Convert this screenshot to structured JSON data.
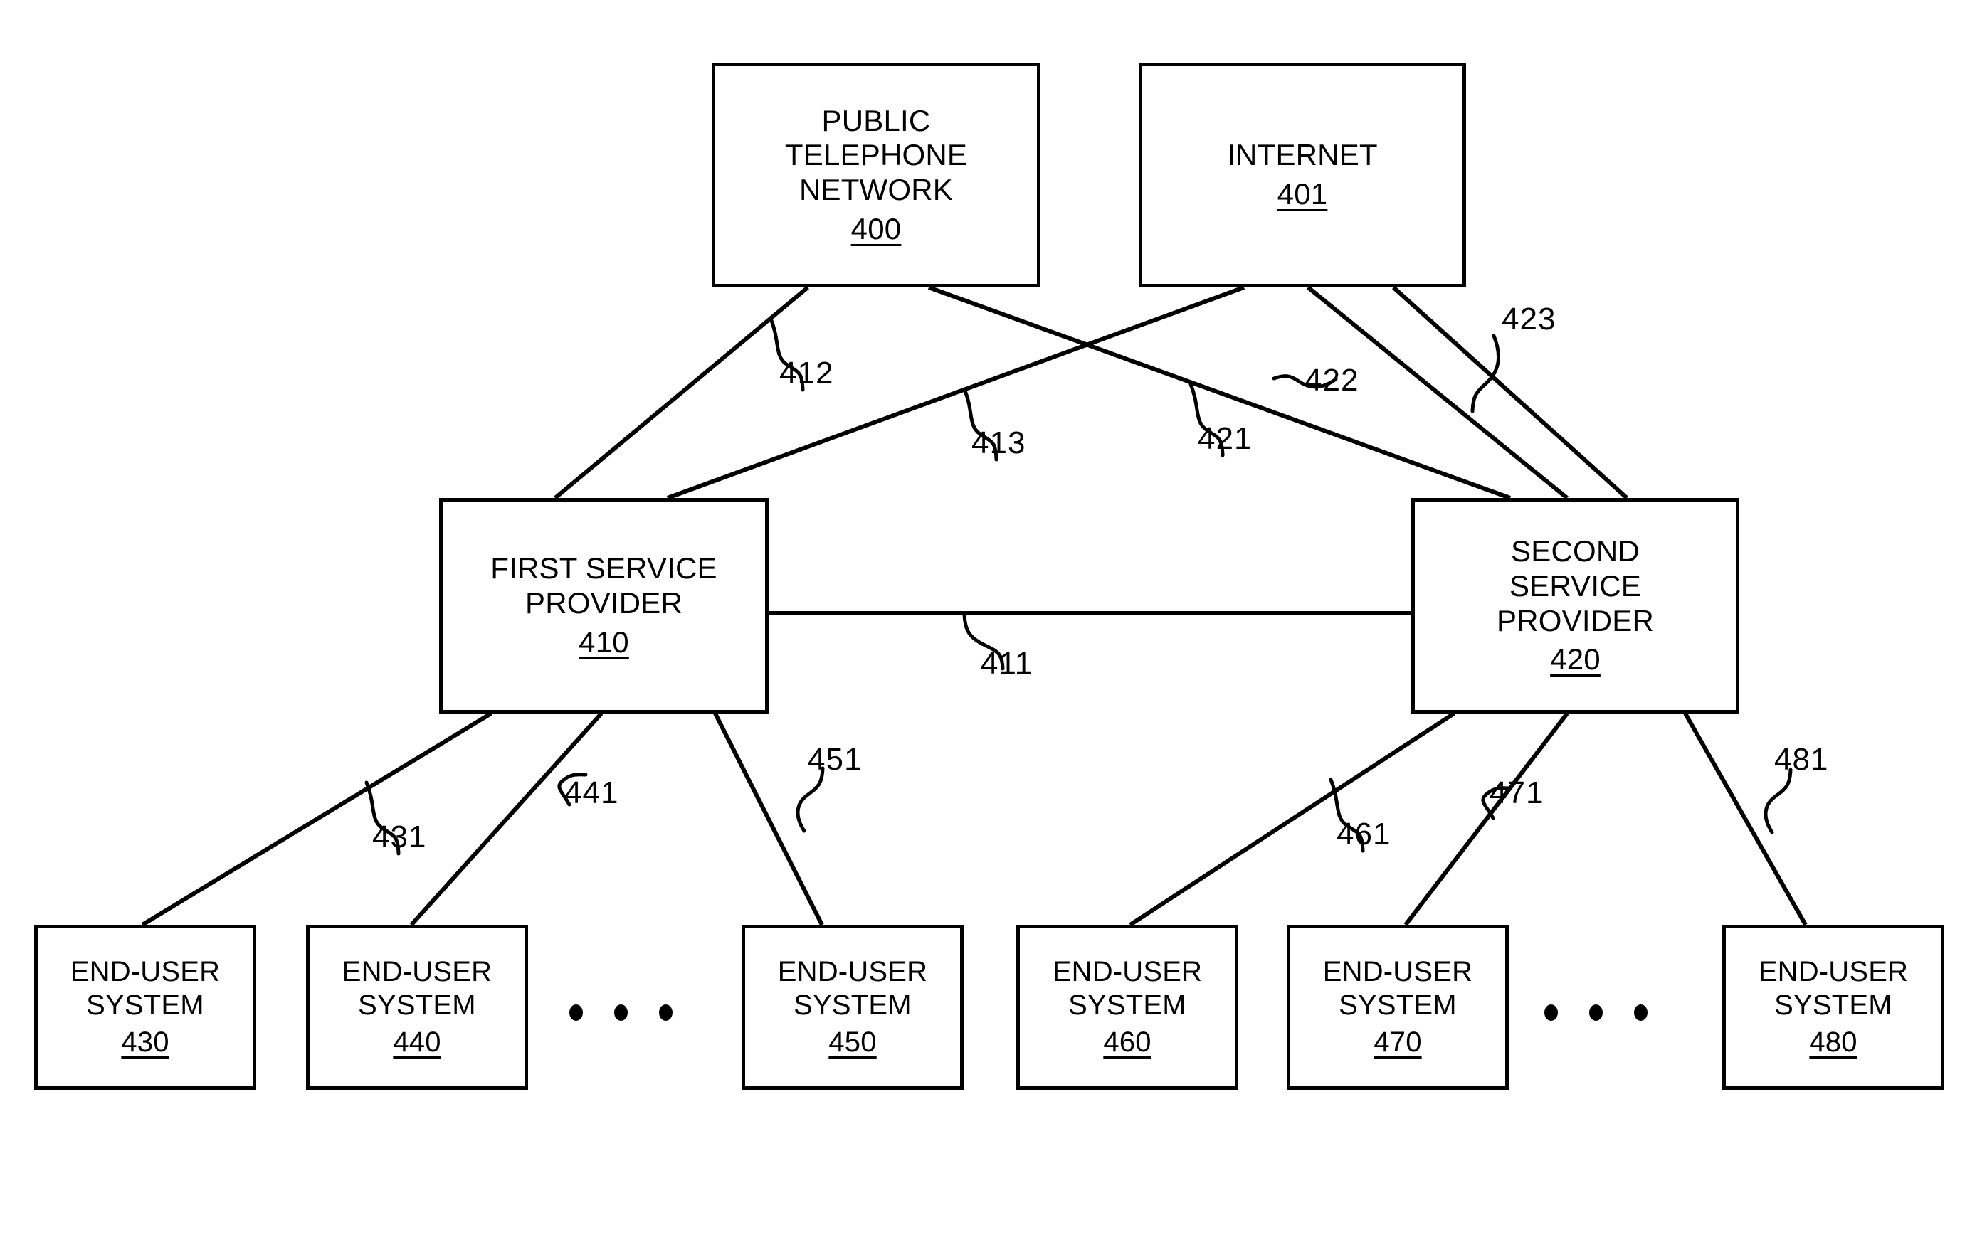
{
  "figure": {
    "kind": "patent-network-diagram",
    "background_color": "#ffffff",
    "line_color": "#000000"
  },
  "nodes": {
    "pstn": {
      "title": "PUBLIC\nTELEPHONE\nNETWORK",
      "ref": "400"
    },
    "internet": {
      "title": "INTERNET",
      "ref": "401"
    },
    "first_provider": {
      "title": "FIRST SERVICE\nPROVIDER",
      "ref": "410"
    },
    "second_provider": {
      "title": "SECOND\nSERVICE\nPROVIDER",
      "ref": "420"
    },
    "end_user_430": {
      "title": "END-USER\nSYSTEM",
      "ref": "430"
    },
    "end_user_440": {
      "title": "END-USER\nSYSTEM",
      "ref": "440"
    },
    "end_user_450": {
      "title": "END-USER\nSYSTEM",
      "ref": "450"
    },
    "end_user_460": {
      "title": "END-USER\nSYSTEM",
      "ref": "460"
    },
    "end_user_470": {
      "title": "END-USER\nSYSTEM",
      "ref": "470"
    },
    "end_user_480": {
      "title": "END-USER\nSYSTEM",
      "ref": "480"
    }
  },
  "connection_labels": {
    "l411": "411",
    "l412": "412",
    "l413": "413",
    "l421": "421",
    "l422": "422",
    "l423": "423",
    "l431": "431",
    "l441": "441",
    "l451": "451",
    "l461": "461",
    "l471": "471",
    "l481": "481"
  },
  "ellipses": {
    "left": "• • •",
    "right": "• • •"
  }
}
